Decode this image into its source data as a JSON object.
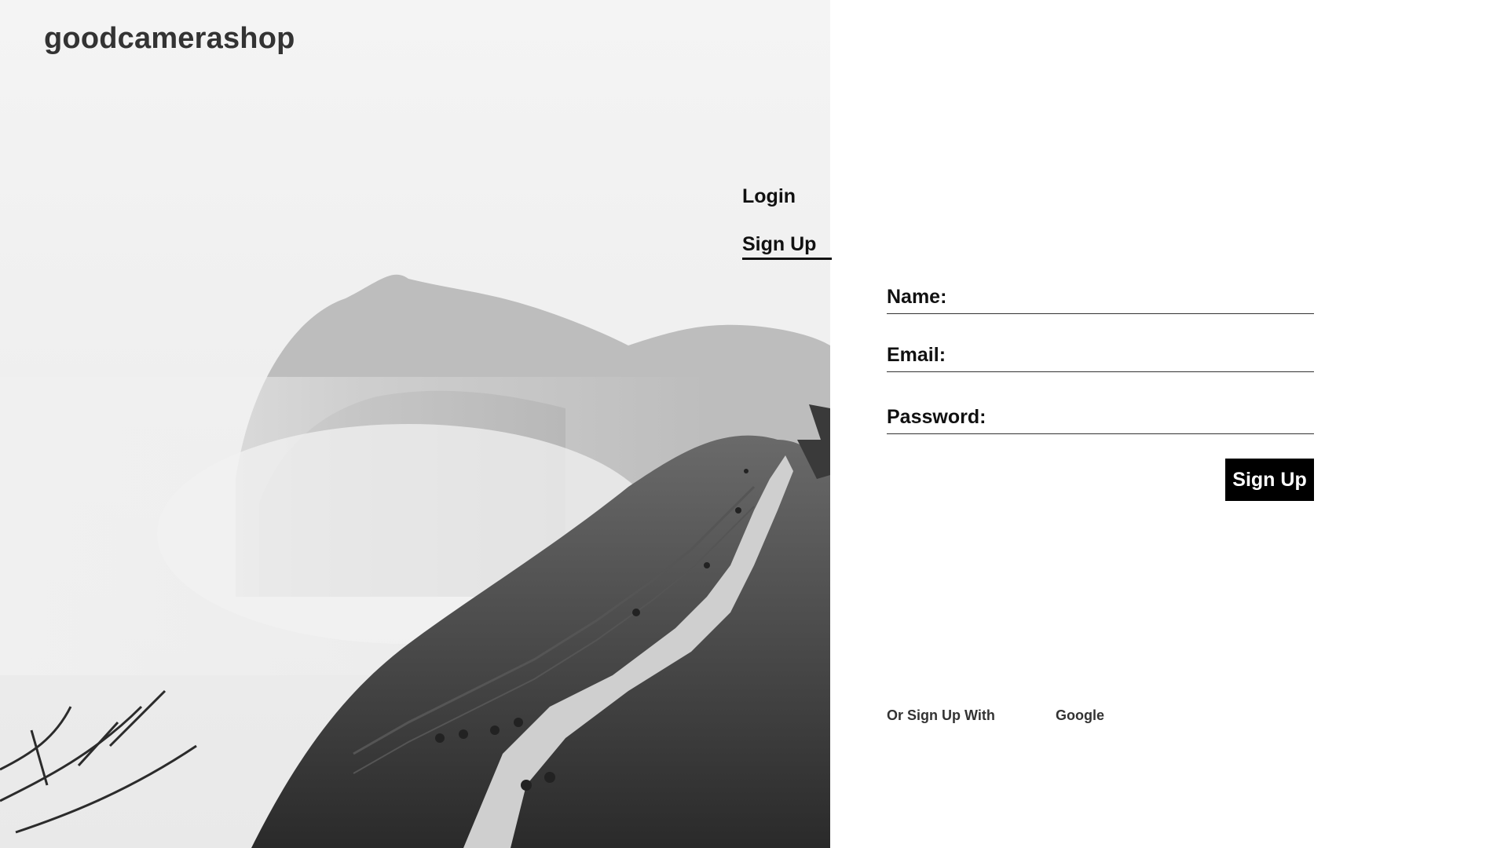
{
  "brand": {
    "name": "goodcamerashop"
  },
  "tabs": {
    "login_label": "Login",
    "signup_label": "Sign Up",
    "active": "signup"
  },
  "form": {
    "name_label": "Name:",
    "name_value": "",
    "email_label": "Email:",
    "email_value": "",
    "password_label": "Password:",
    "password_value": "",
    "submit_label": "Sign Up"
  },
  "alternate": {
    "label": "Or Sign Up With",
    "google_label": "Google"
  },
  "colors": {
    "button_bg": "#000000",
    "button_text": "#ffffff",
    "text": "#111111",
    "brand_text": "#333333"
  }
}
